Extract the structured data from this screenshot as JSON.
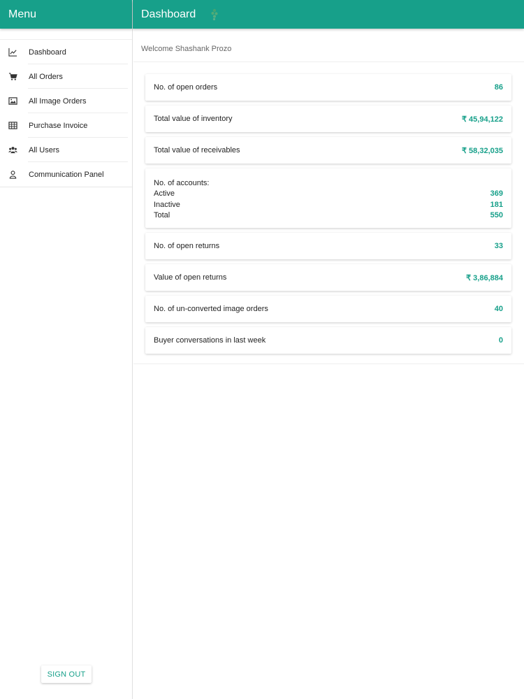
{
  "sidebar": {
    "title": "Menu",
    "items": [
      {
        "label": "Dashboard",
        "icon": "line-chart-icon"
      },
      {
        "label": "All Orders",
        "icon": "cart-icon"
      },
      {
        "label": "All Image Orders",
        "icon": "image-icon"
      },
      {
        "label": "Purchase Invoice",
        "icon": "table-icon"
      },
      {
        "label": "All Users",
        "icon": "users-icon"
      },
      {
        "label": "Communication Panel",
        "icon": "user-outline-icon"
      }
    ],
    "sign_out_label": "SIGN OUT"
  },
  "header": {
    "title": "Dashboard"
  },
  "main": {
    "welcome": "Welcome Shashank Prozo",
    "cards": {
      "open_orders": {
        "label": "No. of open orders",
        "value": "86"
      },
      "inventory": {
        "label": "Total value of inventory",
        "value": "₹ 45,94,122"
      },
      "receivables": {
        "label": "Total value of receivables",
        "value": "₹ 58,32,035"
      },
      "accounts": {
        "label": "No. of accounts:",
        "active_label": "Active",
        "active_value": "369",
        "inactive_label": "Inactive",
        "inactive_value": "181",
        "total_label": "Total",
        "total_value": "550"
      },
      "open_returns": {
        "label": "No. of open returns",
        "value": "33"
      },
      "open_returns_value": {
        "label": "Value of open returns",
        "value": "₹ 3,86,884"
      },
      "unconverted": {
        "label": "No. of un-converted image orders",
        "value": "40"
      },
      "buyer_conversations": {
        "label": "Buyer conversations in last week",
        "value": "0"
      }
    }
  },
  "colors": {
    "accent": "#17a08a",
    "text": "#222222",
    "muted": "#666666"
  }
}
